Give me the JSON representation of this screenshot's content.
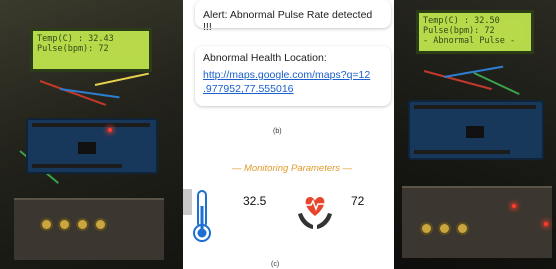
{
  "left_lcd": {
    "line1": "Temp(C) : 32.43",
    "line2": "Pulse(bpm): 72"
  },
  "alert": {
    "text": "Alert: Abnormal Pulse Rate detected !!!"
  },
  "location": {
    "title": "Abnormal Health Location:",
    "link_line1": "http://maps.google.com/maps?q=12",
    "link_line2": ".977952,77.555016"
  },
  "labels": {
    "b": "(b)",
    "c": "(c)"
  },
  "monitoring": {
    "title": "— Monitoring Parameters —",
    "temperature": "32.5",
    "pulse": "72",
    "temperature_icon": "thermometer-icon",
    "pulse_icon": "heart-hands-icon"
  },
  "right_lcd": {
    "line1": "Temp(C) : 32.50",
    "line2": "Pulse(bpm): 72",
    "line3": "- Abnormal Pulse -"
  },
  "colors": {
    "lcd": "#b7d94a",
    "link": "#1a5fcc",
    "accent": "#e29a2e",
    "heart": "#e8452f"
  }
}
